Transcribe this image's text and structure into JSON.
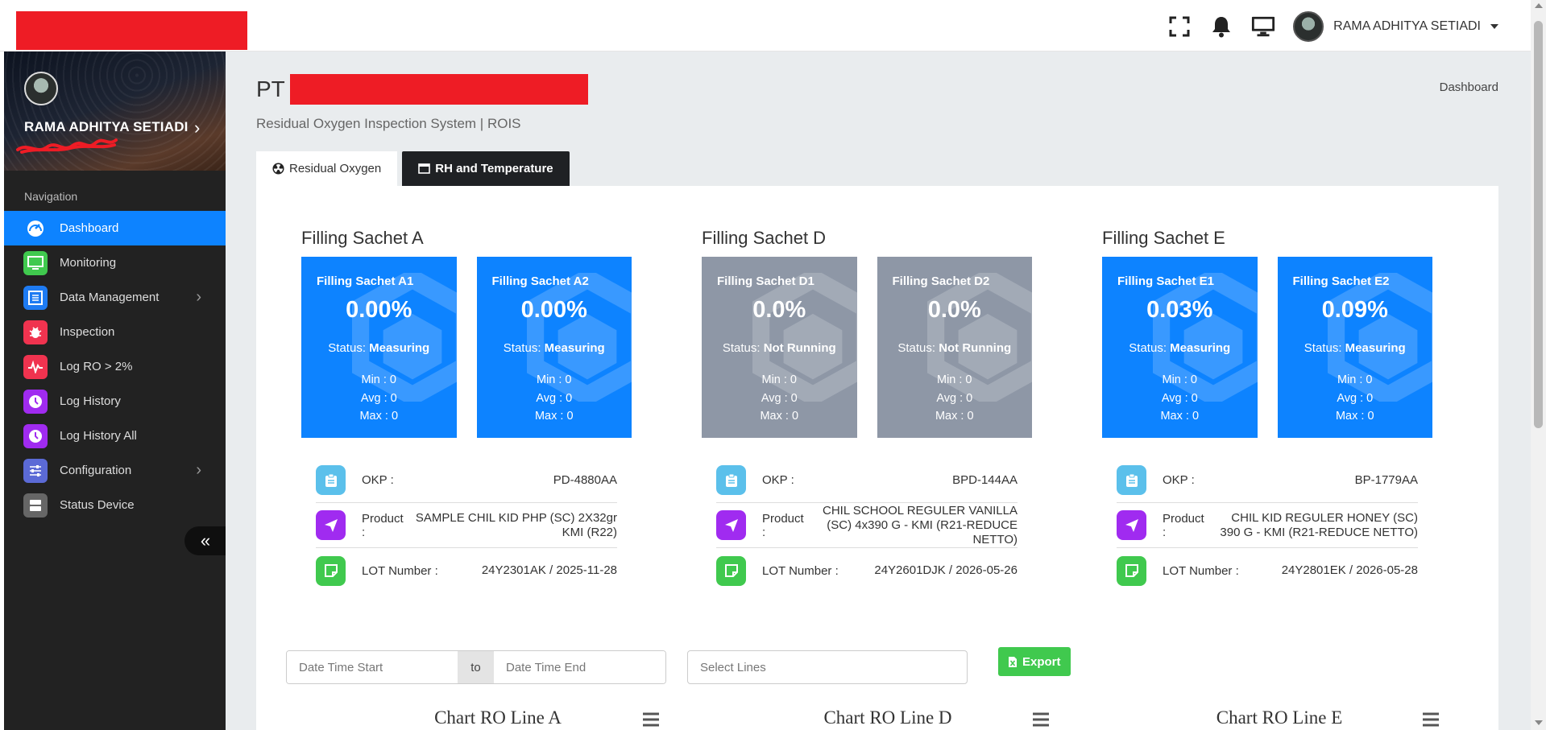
{
  "header": {
    "user_name": "RAMA ADHITYA SETIADI",
    "icons": [
      "fullscreen-icon",
      "bell-icon",
      "monitor-icon"
    ]
  },
  "sidebar": {
    "user_name": "RAMA ADHITYA SETIADI",
    "nav_title": "Navigation",
    "items": [
      {
        "label": "Dashboard",
        "icon": "dashboard-icon",
        "color": "#0d83ff",
        "active": true
      },
      {
        "label": "Monitoring",
        "icon": "monitor-icon",
        "color": "#40c94e"
      },
      {
        "label": "Data Management",
        "icon": "list-icon",
        "color": "#1e7bf2",
        "submenu": true
      },
      {
        "label": "Inspection",
        "icon": "bug-icon",
        "color": "#f0334f"
      },
      {
        "label": "Log RO > 2%",
        "icon": "pulse-icon",
        "color": "#f0334f"
      },
      {
        "label": "Log History",
        "icon": "clock-icon",
        "color": "#a02bf0"
      },
      {
        "label": "Log History All",
        "icon": "clock-icon",
        "color": "#a02bf0"
      },
      {
        "label": "Configuration",
        "icon": "sliders-icon",
        "color": "#5b6ad6",
        "submenu": true
      },
      {
        "label": "Status Device",
        "icon": "server-icon",
        "color": "#666666"
      }
    ]
  },
  "page": {
    "title_prefix": "PT",
    "subtitle": "Residual Oxygen Inspection System | ROIS",
    "breadcrumb": "Dashboard"
  },
  "tabs": [
    {
      "label": "Residual Oxygen",
      "active": true
    },
    {
      "label": "RH and Temperature",
      "active": false
    }
  ],
  "groups": [
    {
      "title": "Filling Sachet A",
      "cards": [
        {
          "name": "Filling Sachet A1",
          "value": "0.00%",
          "status_label": "Status:",
          "status": "Measuring",
          "min": "Min : 0",
          "avg": "Avg : 0",
          "max": "Max : 0",
          "state": "blue"
        },
        {
          "name": "Filling Sachet A2",
          "value": "0.00%",
          "status_label": "Status:",
          "status": "Measuring",
          "min": "Min : 0",
          "avg": "Avg : 0",
          "max": "Max : 0",
          "state": "blue"
        }
      ],
      "okp_label": "OKP :",
      "okp": "PD-4880AA",
      "product_label": "Product :",
      "product": "SAMPLE CHIL KID PHP (SC) 2X32gr KMI (R22)",
      "lot_label": "LOT Number :",
      "lot": "24Y2301AK / 2025-11-28"
    },
    {
      "title": "Filling Sachet D",
      "cards": [
        {
          "name": "Filling Sachet D1",
          "value": "0.0%",
          "status_label": "Status:",
          "status": "Not Running",
          "min": "Min : 0",
          "avg": "Avg : 0",
          "max": "Max : 0",
          "state": "gray"
        },
        {
          "name": "Filling Sachet D2",
          "value": "0.0%",
          "status_label": "Status:",
          "status": "Not Running",
          "min": "Min : 0",
          "avg": "Avg : 0",
          "max": "Max : 0",
          "state": "gray"
        }
      ],
      "okp_label": "OKP :",
      "okp": "BPD-144AA",
      "product_label": "Product :",
      "product": "CHIL SCHOOL REGULER VANILLA (SC) 4x390 G - KMI (R21-REDUCE NETTO)",
      "lot_label": "LOT Number :",
      "lot": "24Y2601DJK / 2026-05-26"
    },
    {
      "title": "Filling Sachet E",
      "cards": [
        {
          "name": "Filling Sachet E1",
          "value": "0.03%",
          "status_label": "Status:",
          "status": "Measuring",
          "min": "Min : 0",
          "avg": "Avg : 0",
          "max": "Max : 0",
          "state": "blue"
        },
        {
          "name": "Filling Sachet E2",
          "value": "0.09%",
          "status_label": "Status:",
          "status": "Measuring",
          "min": "Min : 0",
          "avg": "Avg : 0",
          "max": "Max : 0",
          "state": "blue"
        }
      ],
      "okp_label": "OKP :",
      "okp": "BP-1779AA",
      "product_label": "Product :",
      "product": "CHIL KID REGULER HONEY (SC) 390 G - KMI (R21-REDUCE NETTO)",
      "lot_label": "LOT Number :",
      "lot": "24Y2801EK / 2026-05-28"
    }
  ],
  "filters": {
    "start_placeholder": "Date Time Start",
    "to_label": "to",
    "end_placeholder": "Date Time End",
    "select_placeholder": "Select Lines",
    "export_label": "Export"
  },
  "charts": [
    {
      "title": "Chart RO Line A"
    },
    {
      "title": "Chart RO Line D"
    },
    {
      "title": "Chart RO Line E"
    }
  ],
  "colors": {
    "accent": "#0d83ff",
    "running_card": "#0d83ff",
    "stopped_card": "#8e97a6",
    "sidebar_bg": "#222222",
    "export": "#40c94e",
    "okp_icon": "#5bc0eb",
    "product_icon": "#a02bf0",
    "lot_icon": "#40c94e"
  }
}
